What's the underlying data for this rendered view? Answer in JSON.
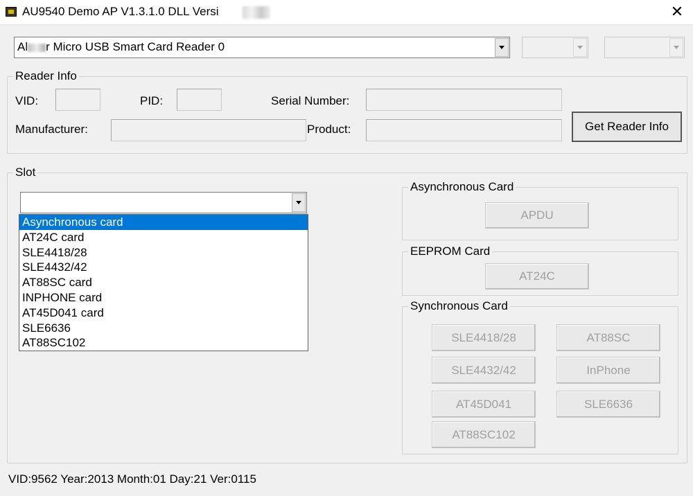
{
  "window": {
    "title": "AU9540 Demo AP V1.3.1.0 DLL Versi",
    "close_label": "✕"
  },
  "reader_select": {
    "value": "Al r Micro USB Smart Card Reader 0",
    "value_prefix": "Al",
    "value_suffix": "r Micro USB Smart Card Reader 0"
  },
  "reader_info": {
    "title": "Reader Info",
    "vid_label": "VID:",
    "pid_label": "PID:",
    "serial_label": "Serial Number:",
    "manufacturer_label": "Manufacturer:",
    "product_label": "Product:",
    "get_info_button": "Get Reader Info"
  },
  "slot": {
    "title": "Slot",
    "selected_value": "",
    "options": [
      "Asynchronous card",
      "AT24C card",
      "SLE4418/28",
      "SLE4432/42",
      "AT88SC card",
      "INPHONE card",
      "AT45D041 card",
      "SLE6636",
      "AT88SC102"
    ],
    "highlighted_index": 0
  },
  "async_card": {
    "title": "Asynchronous Card",
    "apdu_button": "APDU"
  },
  "eeprom_card": {
    "title": "EEPROM Card",
    "at24c_button": "AT24C"
  },
  "sync_card": {
    "title": "Synchronous Card",
    "buttons": [
      "SLE4418/28",
      "AT88SC",
      "SLE4432/42",
      "InPhone",
      "AT45D041",
      "SLE6636",
      "AT88SC102"
    ]
  },
  "status": {
    "text": "VID:9562 Year:2013 Month:01 Day:21 Ver:0115"
  },
  "colors": {
    "selection": "#0078d7",
    "window_bg": "#f0f0f0"
  }
}
